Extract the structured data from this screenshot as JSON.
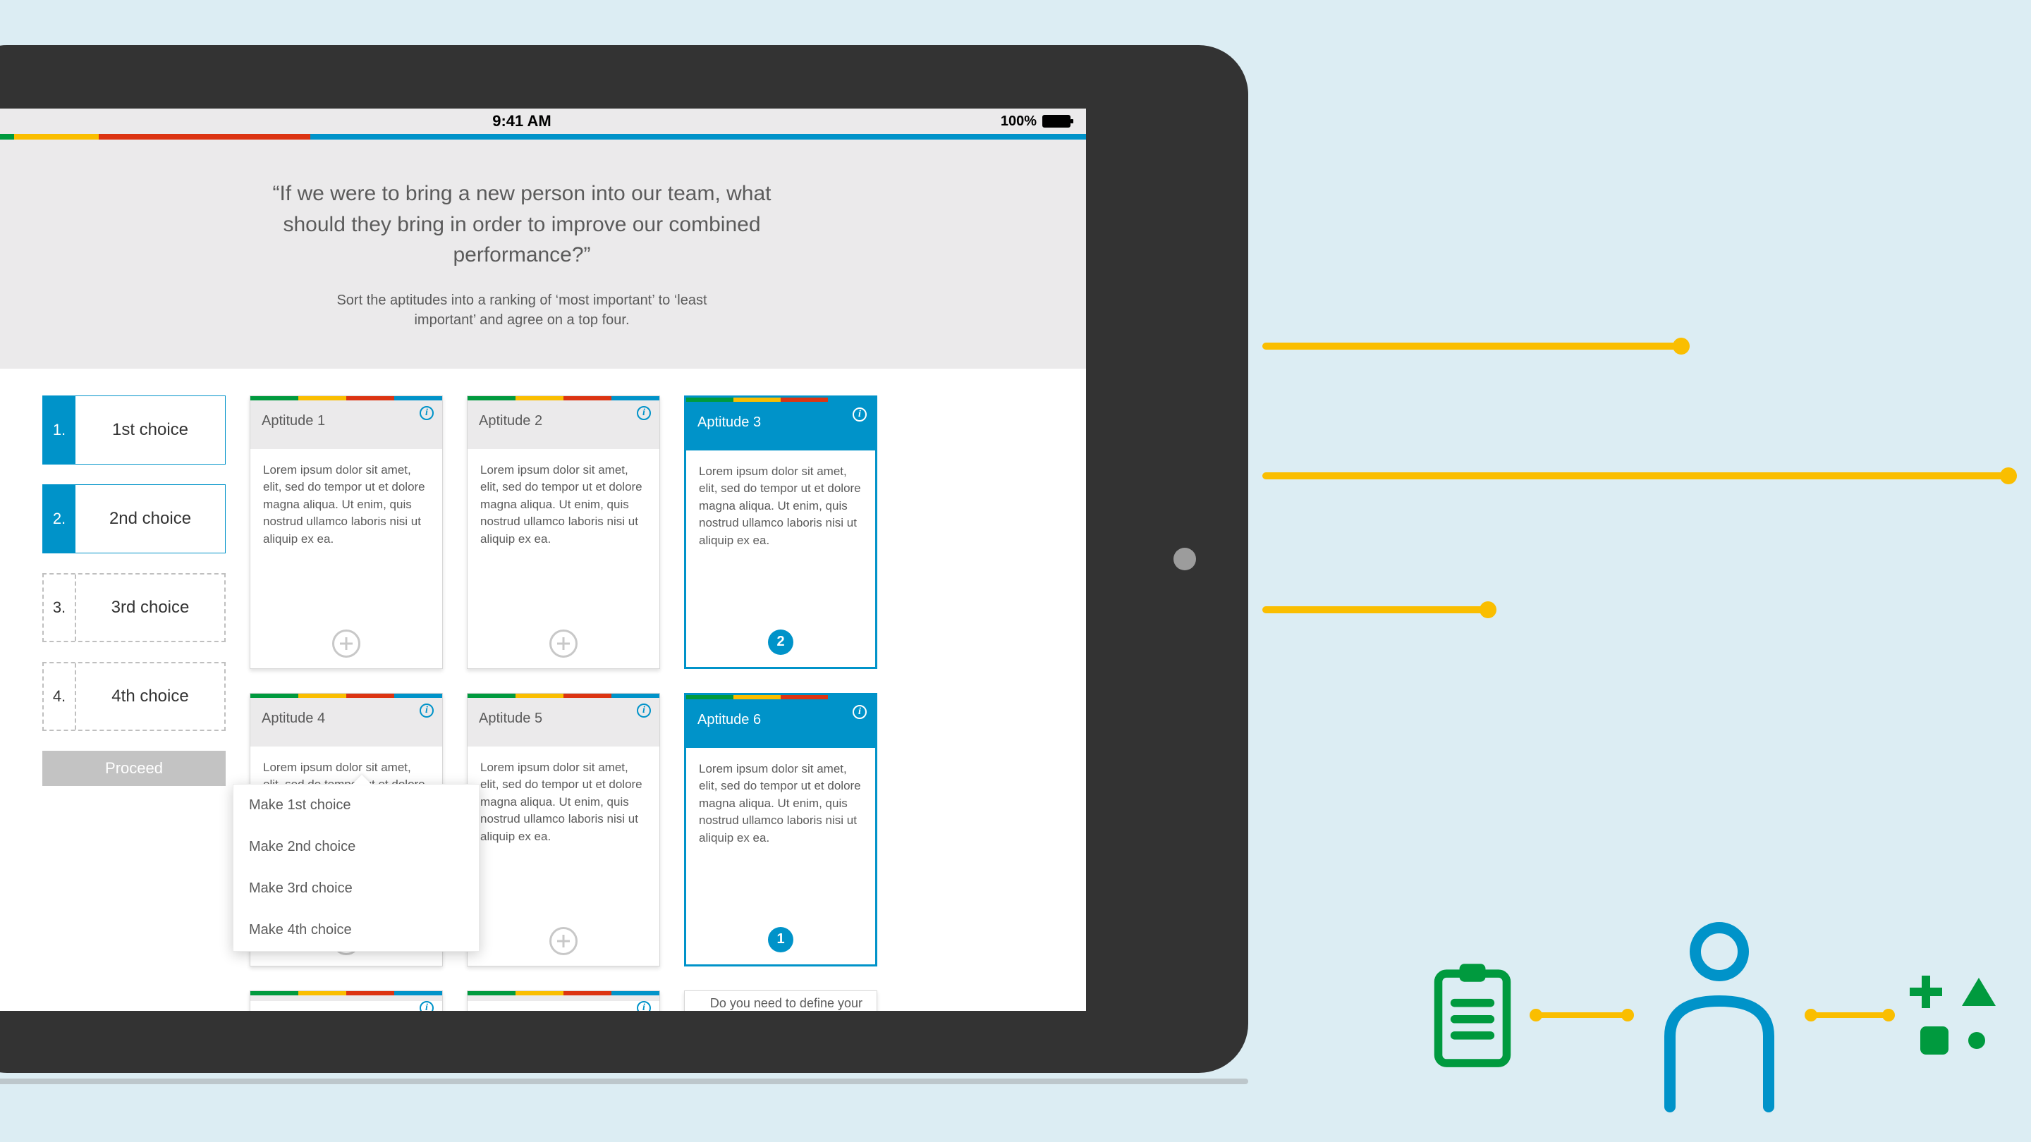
{
  "status": {
    "time": "9:41 AM",
    "battery": "100%"
  },
  "prompt": {
    "question": "“If we were to bring a new person into our team, what should they bring in order to improve our combined performance?”",
    "instruction": "Sort the aptitudes into a ranking of ‘most important’ to ‘least important’ and agree on a top four."
  },
  "choices": [
    {
      "num": "1.",
      "label": "1st choice",
      "state": "solid"
    },
    {
      "num": "2.",
      "label": "2nd choice",
      "state": "solid"
    },
    {
      "num": "3.",
      "label": "3rd choice",
      "state": "dashed"
    },
    {
      "num": "4.",
      "label": "4th choice",
      "state": "dashed"
    }
  ],
  "proceed_label": "Proceed",
  "card_body_text": "Lorem ipsum dolor sit amet, elit, sed do tempor ut  et dolore magna aliqua. Ut enim, quis nostrud ullamco laboris nisi ut aliquip ex ea.",
  "cards": [
    {
      "title": "Aptitude 1",
      "selected": false,
      "rank": null
    },
    {
      "title": "Aptitude 2",
      "selected": false,
      "rank": null
    },
    {
      "title": "Aptitude 3",
      "selected": true,
      "rank": "2"
    },
    {
      "title": "Aptitude 4",
      "selected": false,
      "rank": null
    },
    {
      "title": "Aptitude 5",
      "selected": false,
      "rank": null
    },
    {
      "title": "Aptitude 6",
      "selected": true,
      "rank": "1"
    }
  ],
  "bottom_card_teaser": "Do you need to define your",
  "popover": {
    "items": [
      "Make 1st choice",
      "Make 2nd choice",
      "Make 3rd choice",
      "Make 4th choice"
    ]
  },
  "colors": {
    "blue": "#0093C9",
    "green": "#009A3E",
    "yellow": "#FABE00",
    "red": "#DC3412"
  }
}
